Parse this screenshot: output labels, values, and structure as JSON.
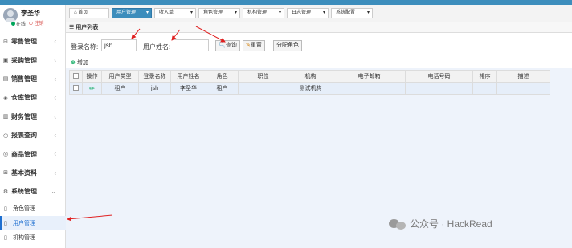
{
  "user": {
    "name": "李圣华",
    "status": "在线",
    "logout": "注销"
  },
  "sidebar": {
    "items": [
      {
        "label": "零售管理",
        "icon": "cart-icon"
      },
      {
        "label": "采购管理",
        "icon": "box-icon"
      },
      {
        "label": "销售管理",
        "icon": "chart-icon"
      },
      {
        "label": "仓库管理",
        "icon": "warehouse-icon"
      },
      {
        "label": "财务管理",
        "icon": "book-icon"
      },
      {
        "label": "报表查询",
        "icon": "report-icon"
      },
      {
        "label": "商品管理",
        "icon": "tag-icon"
      },
      {
        "label": "基本资料",
        "icon": "grid-icon"
      },
      {
        "label": "系统管理",
        "icon": "gear-icon"
      }
    ],
    "subitems": [
      {
        "label": "角色管理"
      },
      {
        "label": "用户管理"
      },
      {
        "label": "机构管理"
      }
    ]
  },
  "tabs": [
    {
      "label": "首页"
    },
    {
      "label": "用户管理"
    },
    {
      "label": "收入单"
    },
    {
      "label": "角色管理"
    },
    {
      "label": "机构管理"
    },
    {
      "label": "日志管理"
    },
    {
      "label": "系统配置"
    }
  ],
  "panel": {
    "title": "用户列表"
  },
  "search": {
    "login_label": "登录名称:",
    "login_value": "jsh",
    "name_label": "用户姓名:",
    "name_value": "",
    "query_btn": "查询",
    "reset_btn": "重置",
    "assign_btn": "分配角色"
  },
  "add_btn": "增加",
  "table": {
    "headers": [
      "操作",
      "用户类型",
      "登录名称",
      "用户姓名",
      "角色",
      "职位",
      "机构",
      "电子邮箱",
      "电话号码",
      "排序",
      "描述"
    ],
    "rows": [
      [
        "",
        "租户",
        "jsh",
        "李圣华",
        "租户",
        "",
        "测试机构",
        "",
        "",
        "",
        ""
      ]
    ]
  },
  "watermark": "公众号 · HackRead"
}
